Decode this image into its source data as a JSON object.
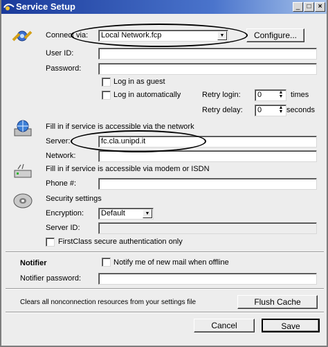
{
  "window": {
    "title": "Service Setup",
    "controls": [
      "minimize-icon",
      "maximize-icon",
      "close-icon"
    ]
  },
  "connection": {
    "connect_via_label": "Connect via:",
    "connect_via_value": "Local Network.fcp",
    "configure_label": "Configure...",
    "user_id_label": "User ID:",
    "password_label": "Password:",
    "guest_label": "Log in as guest",
    "auto_label": "Log in automatically",
    "retry_login_label": "Retry login:",
    "retry_login_value": "0",
    "retry_login_unit": "times",
    "retry_delay_label": "Retry delay:",
    "retry_delay_value": "0",
    "retry_delay_unit": "seconds"
  },
  "network": {
    "heading": "Fill in if service is accessible via the network",
    "server_label": "Server:",
    "server_value": "fc.cla.unipd.it",
    "network_label": "Network:"
  },
  "modem": {
    "heading": "Fill in if service is accessible via modem or ISDN",
    "phone_label": "Phone #:"
  },
  "security": {
    "heading": "Security settings",
    "encryption_label": "Encryption:",
    "encryption_value": "Default",
    "server_id_label": "Server ID:",
    "secure_auth_label": "FirstClass secure authentication only"
  },
  "notifier": {
    "heading": "Notifier",
    "notify_label": "Notify me of new mail when offline",
    "password_label": "Notifier password:"
  },
  "cache": {
    "text": "Clears all nonconnection resources from your settings file",
    "flush_label": "Flush Cache"
  },
  "footer": {
    "cancel_label": "Cancel",
    "save_label": "Save"
  },
  "colors": {
    "title_bar_start": "#1a3a9a",
    "title_bar_end": "#a7c3ea",
    "window_bg": "#ededed"
  }
}
